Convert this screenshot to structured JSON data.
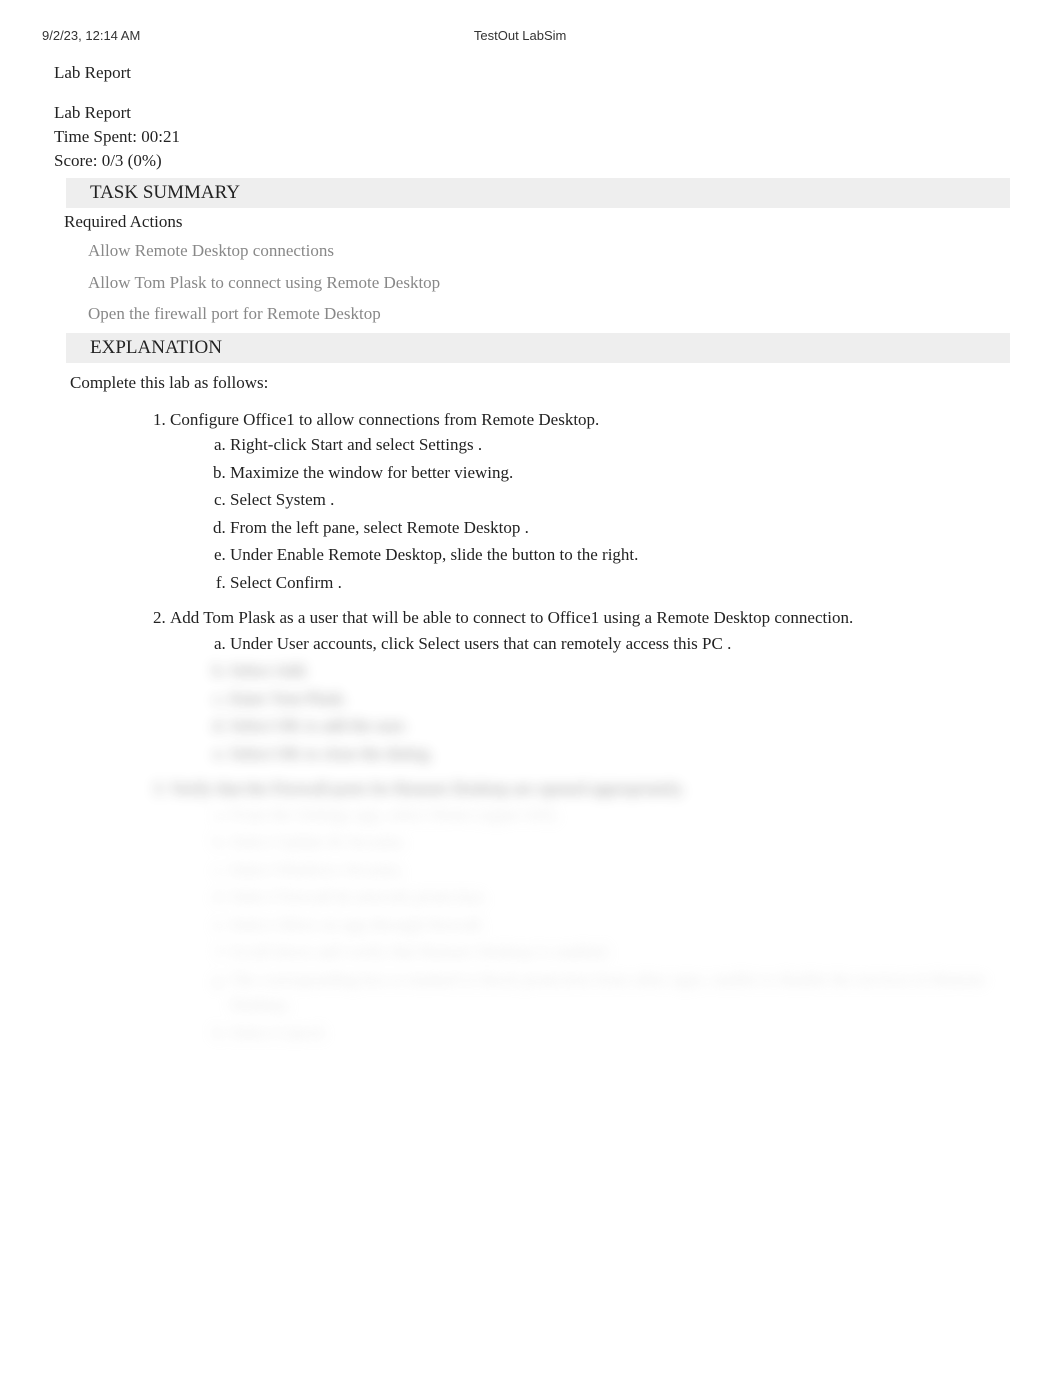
{
  "header": {
    "timestamp": "9/2/23, 12:14 AM",
    "app_name": "TestOut LabSim"
  },
  "page_title": "Lab Report",
  "meta": {
    "report_label": "Lab Report",
    "time_spent_label": "Time Spent: ",
    "time_spent_value": "00:21",
    "score_label": "Score: ",
    "score_value": "0/3 (0%)"
  },
  "task_summary": {
    "header": "TASK SUMMARY",
    "required_label": "Required Actions",
    "actions": [
      "Allow Remote Desktop connections",
      "Allow Tom Plask to connect using Remote Desktop",
      "Open the firewall port for Remote Desktop"
    ]
  },
  "explanation": {
    "header": "EXPLANATION",
    "intro": "Complete this lab as follows:",
    "steps": [
      {
        "text": "Configure Office1 to allow connections from Remote Desktop.",
        "sub": [
          "Right-click Start  and select Settings .",
          "Maximize the window for better viewing.",
          "Select System .",
          "From the left pane, select Remote Desktop .",
          "Under Enable Remote Desktop, slide the button  to the right.",
          "Select Confirm ."
        ]
      },
      {
        "text": "Add Tom Plask as a user that will be able to connect to Office1 using a Remote Desktop connection.",
        "sub": [
          "Under User accounts, click Select users that can remotely access this PC   ."
        ],
        "blurred_sub": [
          "Select Add.",
          "Enter Tom Plask.",
          "Select OK to add the user.",
          "Select OK to close the dialog."
        ]
      }
    ],
    "blurred_step": {
      "text": "Verify that the Firewall ports for Remote Desktop are opened appropriately.",
      "sub": [
        "From the Settings app, select Home (upper-left).",
        "Select Update & Security.",
        "Select Windows Security.",
        "Select Firewall & network protection.",
        "Select Allow an app through firewall.",
        "Scroll down and verify that Remote Desktop is enabled.",
        "The corresponding box is marked to block protection from other apps, unable to disable the services in Remote Desktop.",
        "Select Cancel."
      ]
    }
  }
}
